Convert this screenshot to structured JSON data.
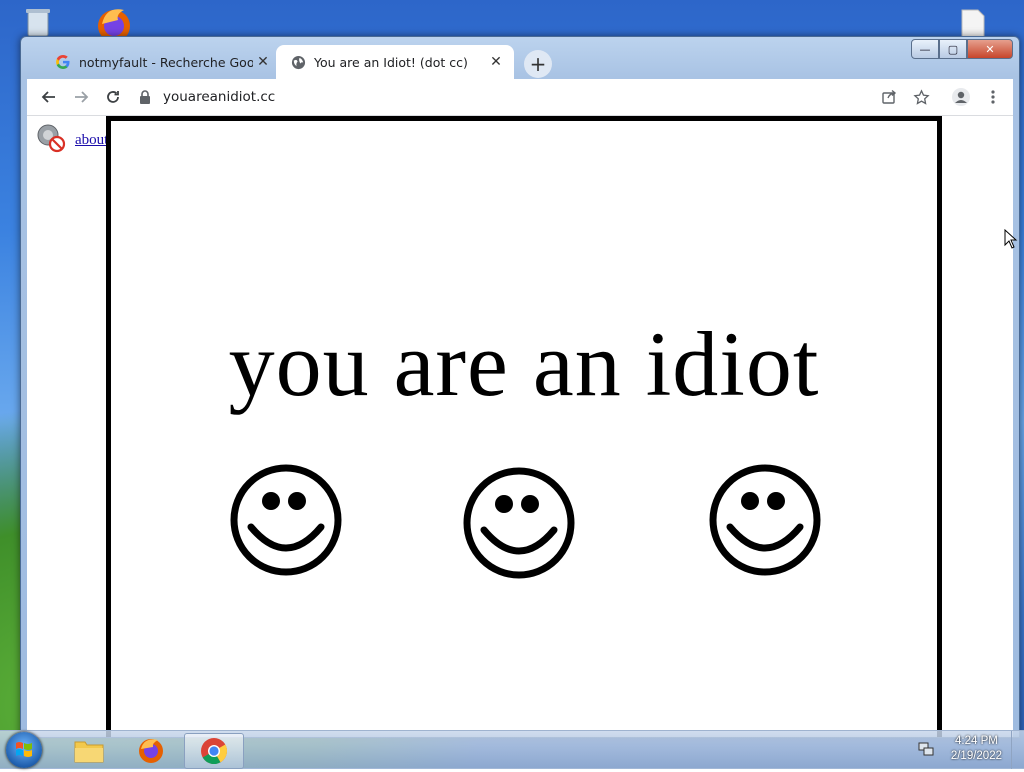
{
  "browser": {
    "tabs": [
      {
        "title": "notmyfault - Recherche Google",
        "favicon": "google-g-icon",
        "active": false
      },
      {
        "title": "You are an Idiot! (dot cc)",
        "favicon": "globe-icon",
        "active": true
      }
    ],
    "close_glyph": "✕",
    "newtab_glyph": "+",
    "url": "youareanidiot.cc"
  },
  "page": {
    "plugin_link": "about flash",
    "headline": "you are an idiot",
    "smiley_count": 3
  },
  "taskbar": {
    "time": "4:24 PM",
    "date": "2/19/2022",
    "apps": [
      "file-explorer-icon",
      "firefox-icon",
      "chrome-icon"
    ],
    "active_app": "chrome-icon"
  },
  "window_controls": {
    "minimize": "—",
    "maximize": "▢",
    "close": "✕"
  },
  "colors": {
    "link": "#1a0dab",
    "frame_border": "#000000",
    "close_button": "#c7452b"
  }
}
